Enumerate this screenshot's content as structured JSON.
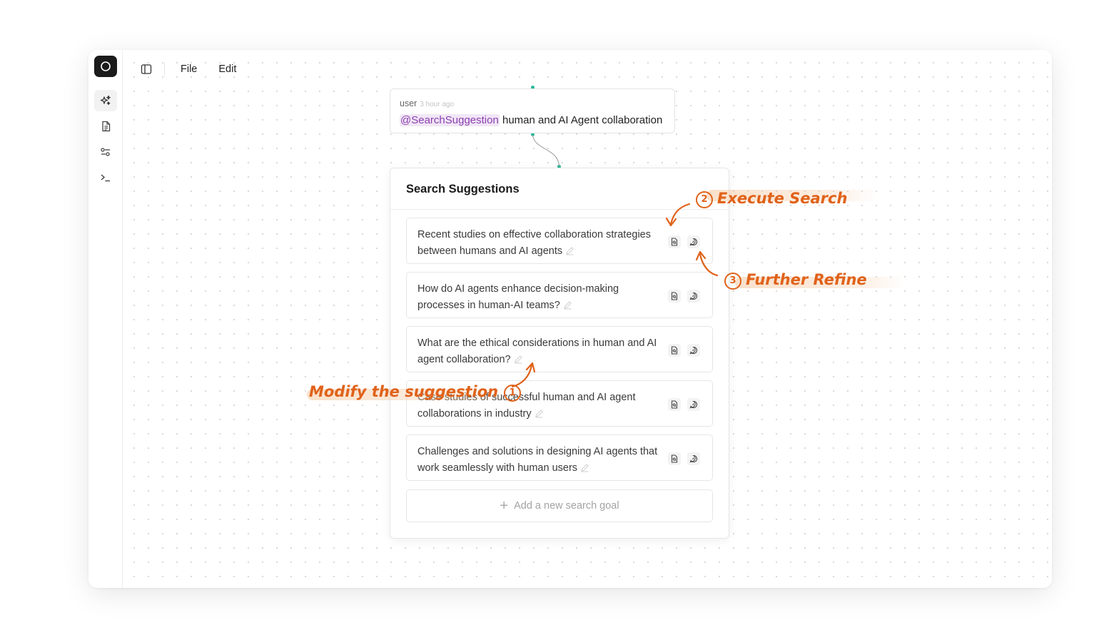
{
  "menu": {
    "file": "File",
    "edit": "Edit"
  },
  "sidebar": {
    "items": [
      {
        "icon": "sparkles-icon",
        "active": true
      },
      {
        "icon": "document-icon",
        "active": false
      },
      {
        "icon": "sliders-icon",
        "active": false
      },
      {
        "icon": "terminal-icon",
        "active": false
      }
    ]
  },
  "user_node": {
    "author": "user",
    "time": "3 hour ago",
    "mention": "@SearchSuggestion",
    "message": " human and AI Agent collaboration"
  },
  "card": {
    "title": "Search Suggestions",
    "items": [
      {
        "text": "Recent studies on effective collaboration strategies between humans and AI agents"
      },
      {
        "text": "How do AI agents enhance decision-making processes in human-AI teams?"
      },
      {
        "text": "What are the ethical considerations in human and AI agent collaboration?"
      },
      {
        "text": "Case studies of successful human and AI agent collaborations in industry"
      },
      {
        "text": "Challenges and solutions in designing AI agents that work seamlessly with human users"
      }
    ],
    "add_label": "Add a new search goal"
  },
  "annotations": {
    "modify": {
      "num": "1",
      "label": "Modify the suggestion"
    },
    "execute": {
      "num": "2",
      "label": "Execute Search"
    },
    "refine": {
      "num": "3",
      "label": "Further Refine"
    }
  },
  "colors": {
    "accent": "#e0621a",
    "mention_bg": "#f1e7f6",
    "mention_fg": "#8b3fb0",
    "connector": "#28b99a"
  }
}
